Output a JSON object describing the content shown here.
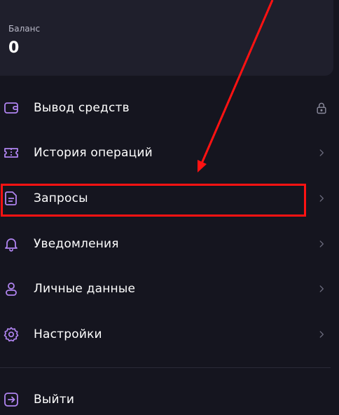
{
  "balance": {
    "label": "Баланс",
    "value": "0"
  },
  "menu": {
    "items": [
      {
        "label": "Вывод средств",
        "icon": "wallet-icon",
        "trailing": "lock-icon"
      },
      {
        "label": "История операций",
        "icon": "ticket-icon",
        "trailing": "chevron-right-icon"
      },
      {
        "label": "Запросы",
        "icon": "document-icon",
        "trailing": "chevron-right-icon"
      },
      {
        "label": "Уведомления",
        "icon": "bell-icon",
        "trailing": "chevron-right-icon"
      },
      {
        "label": "Личные данные",
        "icon": "user-icon",
        "trailing": "chevron-right-icon"
      },
      {
        "label": "Настройки",
        "icon": "gear-icon",
        "trailing": "chevron-right-icon"
      }
    ],
    "logout": {
      "label": "Выйти",
      "icon": "logout-icon"
    }
  },
  "colors": {
    "background": "#15151f",
    "card": "#1f1f2c",
    "accent": "#b084f0",
    "chevron": "#6b6b7d",
    "annotation": "#ff1212"
  }
}
